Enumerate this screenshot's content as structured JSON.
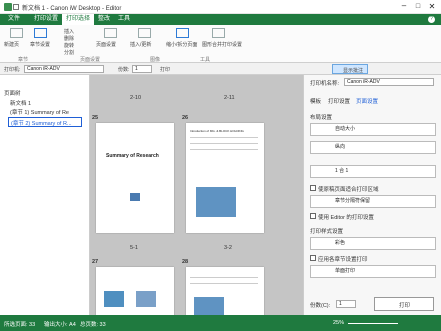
{
  "window": {
    "title": "新文档 1 - Canon iW Desktop - Editor"
  },
  "menu": {
    "tabs": [
      "文件",
      "打印设置",
      "打印选择",
      "整改",
      "工具"
    ]
  },
  "ribbon": {
    "items": [
      "新建页",
      "章节设置",
      "插入",
      "删除",
      "旋转",
      "分割",
      "页面设置",
      "插入/更新",
      "缩小/拆分页面",
      "图形合并打印设置"
    ],
    "groups": [
      "章节",
      "页面设置",
      "图像",
      "工具"
    ]
  },
  "toolbar": {
    "printer_label": "打印机:",
    "printer_value": "Canon iR-ADV",
    "copies_label": "份数:",
    "copies_value": "1",
    "print_button": "打印",
    "preview_label": "显示批注"
  },
  "left": {
    "header": "页面树",
    "root": "新文档 1",
    "chapter1": "(章节 1) Summary of Re",
    "chapter2": "(章节 2) Summary of R..."
  },
  "center": {
    "top_labels": [
      "2-10",
      "2-11"
    ],
    "page_numbers": [
      "25",
      "26",
      "27",
      "28"
    ],
    "page_labels": [
      "5-1",
      "3-2"
    ],
    "doc_heading": "Summary of Research",
    "doc_title_small": "Introduction of MG. & BLOCK HOLDING"
  },
  "right": {
    "printer_label": "打印机名称:",
    "printer_value": "Canon iR-ADV",
    "tabs": [
      "模板",
      "打印设置",
      "页面设置"
    ],
    "sec_layout": "布局设置",
    "page_size": "自动大小",
    "orientation": "纵向",
    "pages_per_sheet": "1 合 1",
    "cb1": "使原稿页面适合打印区域",
    "cb1_select": "章节分隔符保留",
    "cb2": "使用 Editor 的打印设置",
    "sec_color": "打印样式设置",
    "color_value": "彩色",
    "cb3": "应用各章节设置打印",
    "duplex_value": "单面打印",
    "copies_label": "份数(C):",
    "copies_value": "1",
    "print_button": "打印"
  },
  "status": {
    "pages": "所选页面: 33",
    "output": "输出大小: A4",
    "total": "总页数: 33",
    "zoom": "25%"
  }
}
